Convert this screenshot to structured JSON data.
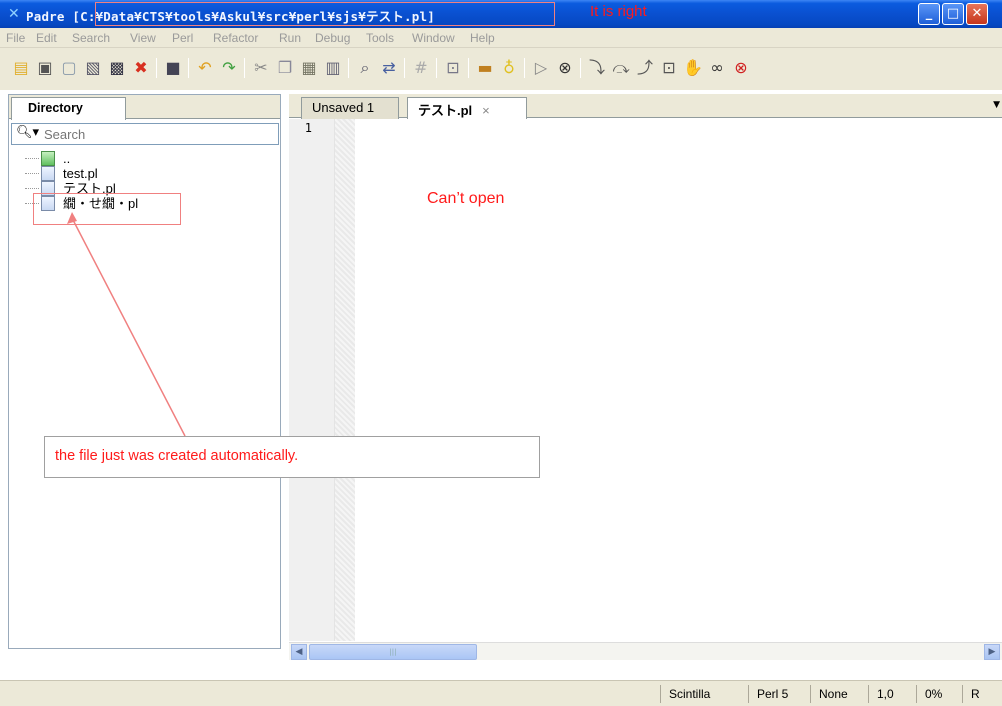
{
  "window": {
    "title": "Padre",
    "path": "[C:¥Data¥CTS¥tools¥Askul¥src¥perl¥sjs¥テスト.pl]",
    "title_note": "It is right"
  },
  "menu": [
    "File",
    "Edit",
    "Search",
    "View",
    "Perl",
    "Refactor",
    "Run",
    "Debug",
    "Tools",
    "Window",
    "Help"
  ],
  "toolbar_icons": [
    "new-file-icon",
    "open-icon",
    "save-icon",
    "save-as-icon",
    "save-all-icon",
    "close-file-icon",
    "console-icon",
    "undo-icon",
    "redo-icon",
    "cut-icon",
    "copy-icon",
    "paste-icon",
    "select-all-icon",
    "find-icon",
    "replace-icon",
    "comment-icon",
    "find-in-files-icon",
    "open-folder-icon",
    "bulb-icon",
    "run-icon",
    "stop-icon",
    "step-in-icon",
    "step-over-icon",
    "step-out-icon",
    "run-to-cursor-icon",
    "breakpoint-icon",
    "watch-icon",
    "quit-debug-icon"
  ],
  "directory": {
    "tab_label": "Directory",
    "search_placeholder": "Search",
    "items": [
      {
        "label": ".."
      },
      {
        "label": "test.pl"
      },
      {
        "label": "テスト.pl"
      },
      {
        "label": "繝・せ繝・pl"
      }
    ]
  },
  "editor": {
    "tabs": [
      {
        "label": "Unsaved 1"
      },
      {
        "label": "テスト.pl",
        "close": "×"
      }
    ],
    "line_number": "1",
    "annotation": "Can’t open"
  },
  "callout_text": "the file just was created automatically.",
  "status": {
    "engine": "Scintilla",
    "language": "Perl 5",
    "mode": "None",
    "position": "1,0",
    "percent": "0%",
    "rw": "R"
  },
  "colors": {
    "annotation": "#ff1a1a",
    "titlebar": "#0a50d0",
    "window_bg": "#ece9d8"
  }
}
